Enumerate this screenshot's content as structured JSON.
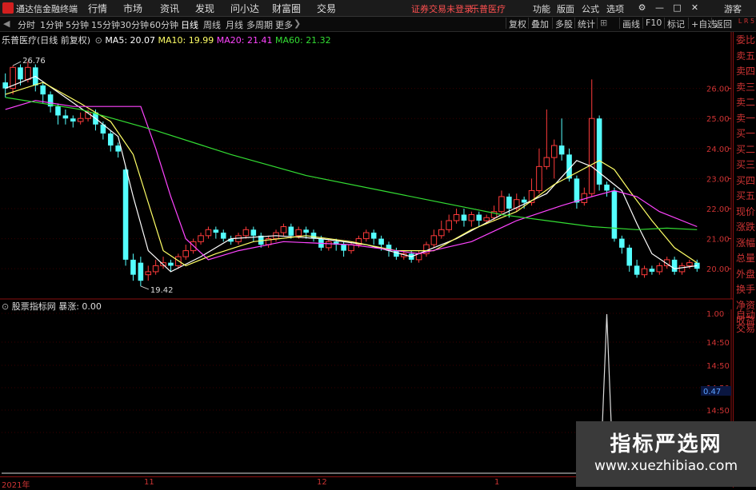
{
  "titlebar": {
    "app_name": "通达信金融终端",
    "menus": [
      "行情",
      "市场",
      "资讯",
      "发现",
      "问小达",
      "财富圈",
      "交易"
    ],
    "notice": "证券交易未登录",
    "stock_title": "乐普医疗",
    "right_menus": [
      "功能",
      "版面",
      "公式",
      "选项"
    ],
    "guest": "游客"
  },
  "toolbar": {
    "periods": [
      "分时",
      "1分钟",
      "5分钟",
      "15分钟",
      "30分钟",
      "60分钟",
      "日线",
      "周线",
      "月线",
      "多周期",
      "更多"
    ],
    "active_period": "日线",
    "right_buttons": [
      "复权",
      "叠加",
      "多股",
      "统计",
      "画线",
      "F10",
      "标记",
      "+自选",
      "返回"
    ]
  },
  "chart_data": [
    {
      "type": "candlestick",
      "title": "乐普医疗(日线 前复权)",
      "indicators": [
        {
          "name": "MA5",
          "value": "20.07",
          "color": "#ffffff"
        },
        {
          "name": "MA10",
          "value": "19.99",
          "color": "#ffff66"
        },
        {
          "name": "MA20",
          "value": "21.41",
          "color": "#ff44ff"
        },
        {
          "name": "MA60",
          "value": "21.32",
          "color": "#33dd33"
        }
      ],
      "y_ticks": [
        "26.00",
        "25.00",
        "24.00",
        "23.00",
        "22.00",
        "21.00",
        "20.00"
      ],
      "ylim": [
        19.1,
        27.4
      ],
      "annotations": [
        {
          "label": "26.76",
          "kind": "high"
        },
        {
          "label": "19.42",
          "kind": "low"
        }
      ],
      "x_labels": [
        "2021年",
        "11",
        "12",
        "1"
      ],
      "candles": [
        [
          26.2,
          26.0,
          26.5,
          25.7
        ],
        [
          26.0,
          26.7,
          26.76,
          25.8
        ],
        [
          26.7,
          26.3,
          26.8,
          26.1
        ],
        [
          26.3,
          26.7,
          26.9,
          26.2
        ],
        [
          26.7,
          26.1,
          26.8,
          25.9
        ],
        [
          26.1,
          25.8,
          26.2,
          25.5
        ],
        [
          25.8,
          25.4,
          25.9,
          25.2
        ],
        [
          25.4,
          25.1,
          25.5,
          24.8
        ],
        [
          25.1,
          25.0,
          25.3,
          24.8
        ],
        [
          25.0,
          24.9,
          25.1,
          24.7
        ],
        [
          24.9,
          25.0,
          25.2,
          24.8
        ],
        [
          25.0,
          25.2,
          25.3,
          24.9
        ],
        [
          25.2,
          24.8,
          25.3,
          24.6
        ],
        [
          24.8,
          24.5,
          24.9,
          24.3
        ],
        [
          24.5,
          24.1,
          24.6,
          23.9
        ],
        [
          24.1,
          23.9,
          24.2,
          23.7
        ],
        [
          23.3,
          20.3,
          23.4,
          20.1
        ],
        [
          20.3,
          19.8,
          20.5,
          19.6
        ],
        [
          20.2,
          19.6,
          20.4,
          19.42
        ],
        [
          19.8,
          19.9,
          20.1,
          19.6
        ],
        [
          19.9,
          20.1,
          20.3,
          19.8
        ],
        [
          20.1,
          20.2,
          20.4,
          20.0
        ],
        [
          20.2,
          20.1,
          20.3,
          19.9
        ],
        [
          20.1,
          20.4,
          20.5,
          20.0
        ],
        [
          20.4,
          20.6,
          20.8,
          20.3
        ],
        [
          20.6,
          20.9,
          21.0,
          20.5
        ],
        [
          20.9,
          21.1,
          21.2,
          20.8
        ],
        [
          21.1,
          21.3,
          21.4,
          21.0
        ],
        [
          21.3,
          21.2,
          21.4,
          21.0
        ],
        [
          21.2,
          21.0,
          21.3,
          20.9
        ],
        [
          21.0,
          20.9,
          21.1,
          20.8
        ],
        [
          20.9,
          21.1,
          21.2,
          20.8
        ],
        [
          21.1,
          21.3,
          21.4,
          21.0
        ],
        [
          21.3,
          21.1,
          21.4,
          20.9
        ],
        [
          21.1,
          20.8,
          21.2,
          20.7
        ],
        [
          20.8,
          21.0,
          21.1,
          20.7
        ],
        [
          21.0,
          21.2,
          21.3,
          20.9
        ],
        [
          21.2,
          21.4,
          21.5,
          21.1
        ],
        [
          21.4,
          21.1,
          21.5,
          21.0
        ],
        [
          21.1,
          21.3,
          21.4,
          21.0
        ],
        [
          21.3,
          21.2,
          21.4,
          21.0
        ],
        [
          21.2,
          21.0,
          21.3,
          20.9
        ],
        [
          21.0,
          20.7,
          21.1,
          20.6
        ],
        [
          20.7,
          20.9,
          21.0,
          20.6
        ],
        [
          20.9,
          20.8,
          21.0,
          20.6
        ],
        [
          20.8,
          20.6,
          20.9,
          20.4
        ],
        [
          20.6,
          20.8,
          20.9,
          20.5
        ],
        [
          20.8,
          21.0,
          21.1,
          20.7
        ],
        [
          21.0,
          21.2,
          21.3,
          20.9
        ],
        [
          21.2,
          21.0,
          21.3,
          20.8
        ],
        [
          21.0,
          20.8,
          21.1,
          20.6
        ],
        [
          20.8,
          20.6,
          20.9,
          20.4
        ],
        [
          20.6,
          20.4,
          20.7,
          20.3
        ],
        [
          20.4,
          20.5,
          20.6,
          20.3
        ],
        [
          20.5,
          20.3,
          20.6,
          20.2
        ],
        [
          20.3,
          20.5,
          20.6,
          20.2
        ],
        [
          20.5,
          20.8,
          20.9,
          20.4
        ],
        [
          20.8,
          21.1,
          21.3,
          20.7
        ],
        [
          21.1,
          21.3,
          21.6,
          21.0
        ],
        [
          21.3,
          21.6,
          21.8,
          21.2
        ],
        [
          21.6,
          21.8,
          22.0,
          21.5
        ],
        [
          21.8,
          21.6,
          22.0,
          21.4
        ],
        [
          21.6,
          21.8,
          21.9,
          21.4
        ],
        [
          21.8,
          21.6,
          21.9,
          21.4
        ],
        [
          21.6,
          21.7,
          21.8,
          21.5
        ],
        [
          21.7,
          21.9,
          22.1,
          21.6
        ],
        [
          21.9,
          22.4,
          22.6,
          21.8
        ],
        [
          22.4,
          22.0,
          22.5,
          21.7
        ],
        [
          22.0,
          22.3,
          22.5,
          21.9
        ],
        [
          22.3,
          22.2,
          22.4,
          22.0
        ],
        [
          22.2,
          22.6,
          23.0,
          22.1
        ],
        [
          22.6,
          23.4,
          24.0,
          22.5
        ],
        [
          23.4,
          23.7,
          25.3,
          23.3
        ],
        [
          23.7,
          24.1,
          24.3,
          23.0
        ],
        [
          24.1,
          23.8,
          25.0,
          23.6
        ],
        [
          23.8,
          23.0,
          24.0,
          22.9
        ],
        [
          23.0,
          22.2,
          23.1,
          22.0
        ],
        [
          22.2,
          22.5,
          22.7,
          22.1
        ],
        [
          22.5,
          25.0,
          26.3,
          22.4
        ],
        [
          25.0,
          22.8,
          25.1,
          22.6
        ],
        [
          22.8,
          22.6,
          22.9,
          22.4
        ],
        [
          22.6,
          21.0,
          22.7,
          20.9
        ],
        [
          21.0,
          20.7,
          21.1,
          20.5
        ],
        [
          20.7,
          20.1,
          20.8,
          19.9
        ],
        [
          20.1,
          19.8,
          20.3,
          19.7
        ],
        [
          19.8,
          20.0,
          20.1,
          19.7
        ],
        [
          20.0,
          19.9,
          20.1,
          19.8
        ],
        [
          19.9,
          20.1,
          20.2,
          19.8
        ],
        [
          20.1,
          20.3,
          20.4,
          20.0
        ],
        [
          20.3,
          19.9,
          20.4,
          19.8
        ],
        [
          19.9,
          20.1,
          20.2,
          19.8
        ],
        [
          20.1,
          20.2,
          20.3,
          20.0
        ],
        [
          20.2,
          20.0,
          20.3,
          19.9
        ]
      ],
      "ma_lines": {
        "MA5": [
          [
            0,
            26.0
          ],
          [
            4,
            26.4
          ],
          [
            8,
            25.7
          ],
          [
            12,
            25.0
          ],
          [
            15,
            24.4
          ],
          [
            17,
            22.4
          ],
          [
            19,
            20.6
          ],
          [
            22,
            19.9
          ],
          [
            26,
            20.4
          ],
          [
            30,
            21.0
          ],
          [
            36,
            21.1
          ],
          [
            42,
            21.0
          ],
          [
            48,
            20.8
          ],
          [
            54,
            20.4
          ],
          [
            60,
            21.0
          ],
          [
            66,
            21.8
          ],
          [
            72,
            22.5
          ],
          [
            76,
            23.6
          ],
          [
            78,
            23.4
          ],
          [
            80,
            23.0
          ],
          [
            82,
            22.6
          ],
          [
            84,
            21.5
          ],
          [
            86,
            20.5
          ],
          [
            89,
            20.0
          ],
          [
            92,
            20.1
          ]
        ],
        "MA10": [
          [
            0,
            25.8
          ],
          [
            5,
            26.2
          ],
          [
            10,
            25.5
          ],
          [
            14,
            24.9
          ],
          [
            17,
            23.8
          ],
          [
            19,
            22.2
          ],
          [
            21,
            20.6
          ],
          [
            24,
            20.1
          ],
          [
            28,
            20.5
          ],
          [
            33,
            20.9
          ],
          [
            40,
            21.1
          ],
          [
            46,
            20.9
          ],
          [
            52,
            20.6
          ],
          [
            57,
            20.6
          ],
          [
            62,
            21.3
          ],
          [
            68,
            21.9
          ],
          [
            73,
            22.8
          ],
          [
            76,
            23.2
          ],
          [
            79,
            23.6
          ],
          [
            81,
            23.3
          ],
          [
            83,
            22.6
          ],
          [
            86,
            21.6
          ],
          [
            89,
            20.7
          ],
          [
            92,
            20.2
          ]
        ],
        "MA20": [
          [
            0,
            25.3
          ],
          [
            4,
            25.6
          ],
          [
            9,
            25.4
          ],
          [
            18,
            25.4
          ],
          [
            20,
            24.0
          ],
          [
            22,
            22.4
          ],
          [
            24,
            21.0
          ],
          [
            27,
            20.3
          ],
          [
            31,
            20.6
          ],
          [
            37,
            20.9
          ],
          [
            46,
            20.8
          ],
          [
            55,
            20.5
          ],
          [
            62,
            20.9
          ],
          [
            68,
            21.6
          ],
          [
            74,
            22.1
          ],
          [
            78,
            22.4
          ],
          [
            81,
            22.6
          ],
          [
            84,
            22.4
          ],
          [
            87,
            21.9
          ],
          [
            92,
            21.4
          ]
        ],
        "MA60": [
          [
            0,
            25.7
          ],
          [
            10,
            25.3
          ],
          [
            20,
            24.6
          ],
          [
            30,
            23.8
          ],
          [
            40,
            23.1
          ],
          [
            50,
            22.6
          ],
          [
            60,
            22.1
          ],
          [
            66,
            21.8
          ],
          [
            72,
            21.6
          ],
          [
            78,
            21.4
          ],
          [
            84,
            21.3
          ],
          [
            88,
            21.35
          ],
          [
            92,
            21.3
          ]
        ]
      }
    },
    {
      "type": "line",
      "title": "股票指标网 暴涨",
      "value_label": "0.00",
      "y_ticks": [
        "1.00",
        "14:50",
        "14:50",
        "14:50",
        "14:50",
        "0.40"
      ],
      "ylim": [
        0,
        1
      ],
      "marker": "0.47",
      "series": [
        {
          "values": [
            0,
            0,
            0,
            1,
            0,
            0,
            0
          ]
        }
      ]
    }
  ],
  "side_panel": {
    "top_label": "L R 5",
    "items": [
      "委比",
      "卖五",
      "卖四",
      "卖三",
      "卖二",
      "卖一",
      "买一",
      "买二",
      "买三",
      "买四",
      "买五",
      "现价",
      "涨跌",
      "涨幅",
      "总量",
      "外盘",
      "换手",
      "净资",
      "收益"
    ],
    "lower_items": [
      "自动",
      "交易"
    ]
  },
  "watermark": {
    "title": "指标严选网",
    "url": "www.xuezhibiao.com"
  },
  "colors": {
    "up": "#ff3b3b",
    "down": "#54ffff",
    "axis": "#c33333",
    "grid": "#3a0000"
  }
}
